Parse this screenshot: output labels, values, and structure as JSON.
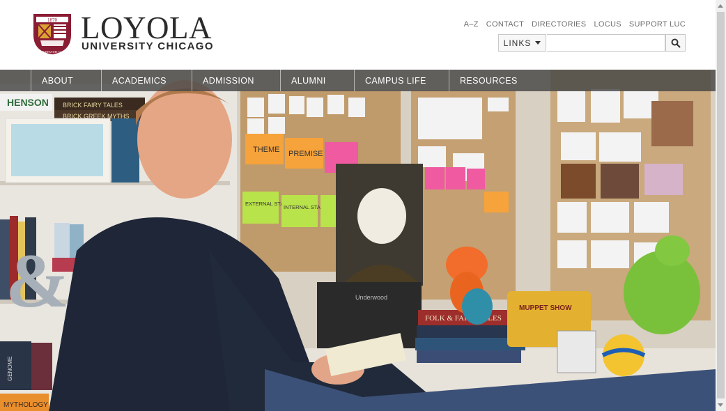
{
  "logo": {
    "wordmark": "LOYOLA",
    "subtitle": "UNIVERSITY CHICAGO",
    "seal_year": "1870",
    "seal_motto": "AD MAIOREM DEI GLORIAM"
  },
  "utility_links": [
    "A–Z",
    "CONTACT",
    "DIRECTORIES",
    "LOCUS",
    "SUPPORT LUC"
  ],
  "links_button": "LINKS",
  "search": {
    "placeholder": ""
  },
  "nav": [
    "ABOUT",
    "ACADEMICS",
    "ADMISSION",
    "ALUMNI",
    "CAMPUS LIFE",
    "RESOURCES"
  ],
  "hero": {
    "note_theme": "THEME",
    "note_premise": "PREMISE",
    "note_external": "EXTERNAL STAKES",
    "note_internal": "INTERNAL STAKES",
    "book_title": "FOLK & FAIRY TALES",
    "sign_henson": "HENSON",
    "books_brick_fairy": "BRICK FAIRY TALES",
    "books_brick_greek": "BRICK GREEK MYTHS",
    "book_mythology": "MYTHOLOGY",
    "book_genome": "GENOME",
    "lunchbox": "MUPPET SHOW",
    "typewriter": "Underwood"
  },
  "colors": {
    "maroon": "#8a1c33",
    "gold": "#d9a232",
    "nav_bg": "#464646",
    "sticky_orange": "#f6a33b",
    "sticky_pink": "#ef5aa1",
    "sticky_green": "#b9e34a"
  }
}
